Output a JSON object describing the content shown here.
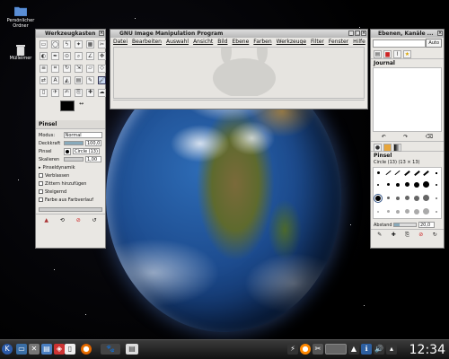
{
  "desktop": {
    "icons": [
      {
        "label": "Persönlicher Ordner"
      },
      {
        "label": "Mülleimer"
      }
    ]
  },
  "toolbox": {
    "title": "Werkzeugkasten",
    "panel_title": "Pinsel",
    "mode_label": "Modus:",
    "mode_value": "Normal",
    "opacity_label": "Deckkraft",
    "opacity_value": "100,0",
    "brush_label": "Pinsel",
    "brush_value": "Circle (13)",
    "scale_label": "Skalieren",
    "scale_value": "1,00",
    "dynamics_label": "Pinseldynamik",
    "option_fade": "Verblassen",
    "option_jitter": "Zittern hinzufügen",
    "option_incremental": "Steigernd",
    "option_gradient": "Farbe aus Farbverlauf"
  },
  "gimp_main": {
    "title": "GNU Image Manipulation Program",
    "menu": [
      "Datei",
      "Bearbeiten",
      "Auswahl",
      "Ansicht",
      "Bild",
      "Ebene",
      "Farben",
      "Werkzeuge",
      "Filter",
      "Fenster",
      "Hilfe"
    ]
  },
  "layers_dock": {
    "title": "Ebenen, Kanäle ...",
    "auto_button": "Auto",
    "journal_label": "Journal",
    "brushes_label": "Pinsel",
    "brush_name": "Circle (13) (13 × 13)",
    "spacing_label": "Abstand",
    "spacing_value": "20,0"
  },
  "taskbar": {
    "clock": "12:34"
  },
  "colors": {
    "window_bg": "#e9e7e3",
    "taskbar": "#1a1a1a"
  }
}
